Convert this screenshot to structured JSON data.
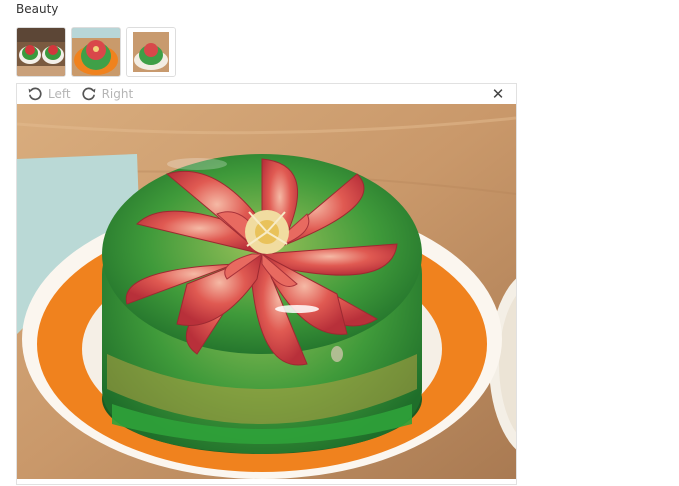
{
  "gallery": {
    "title": "Beauty",
    "thumbnails": [
      {
        "icon": "jelly-cake-pair-thumbnail"
      },
      {
        "icon": "jelly-cake-flower-thumbnail"
      },
      {
        "icon": "jelly-cake-plate-thumbnail"
      }
    ]
  },
  "viewer": {
    "rotate_left_label": "Left",
    "rotate_right_label": "Right",
    "close_icon": "close-icon",
    "image_subject": "jelly-flower-cake-photo"
  },
  "colors": {
    "table_wood": "#c99a6b",
    "plate_orange": "#f0821e",
    "jelly_green": "#2f9a3a",
    "flower_red": "#d9474a",
    "toolbar_text": "#b5b5b5"
  }
}
